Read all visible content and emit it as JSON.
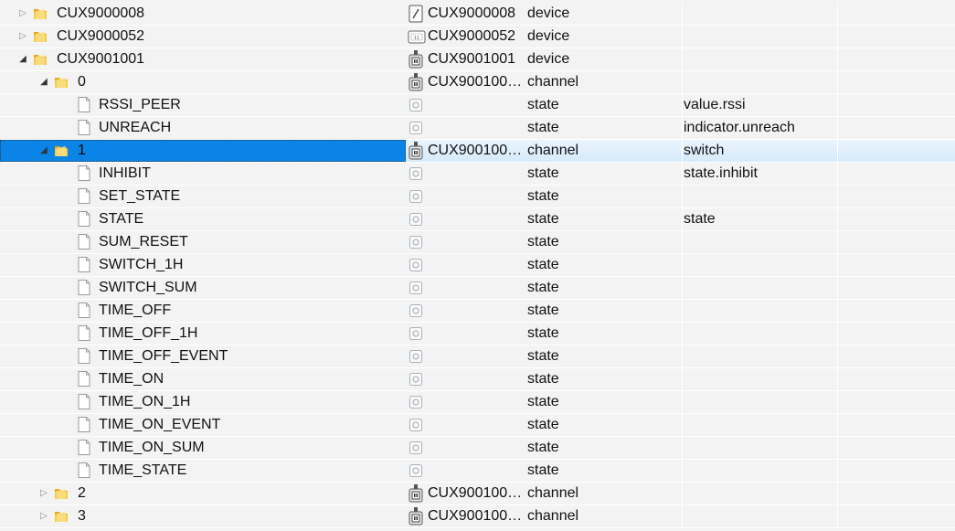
{
  "rows": [
    {
      "level": 1,
      "toggle": "collapsed",
      "kind": "folder",
      "name": "CUX9000008",
      "icon": "wall-switch-device-icon",
      "id": "CUX9000008",
      "type": "device",
      "role": ""
    },
    {
      "level": 1,
      "toggle": "collapsed",
      "kind": "folder",
      "name": "CUX9000052",
      "icon": "display-device-icon",
      "id": "CUX9000052",
      "type": "device",
      "role": ""
    },
    {
      "level": 1,
      "toggle": "expanded",
      "kind": "folder",
      "name": "CUX9001001",
      "icon": "plug-device-icon",
      "id": "CUX9001001",
      "type": "device",
      "role": ""
    },
    {
      "level": 2,
      "toggle": "expanded",
      "kind": "folder",
      "name": "0",
      "icon": "plug-device-icon",
      "id": "CUX900100…",
      "type": "channel",
      "role": ""
    },
    {
      "level": 3,
      "toggle": "none",
      "kind": "file",
      "name": "RSSI_PEER",
      "icon": "state-icon",
      "id": "",
      "type": "state",
      "role": "value.rssi"
    },
    {
      "level": 3,
      "toggle": "none",
      "kind": "file",
      "name": "UNREACH",
      "icon": "state-icon",
      "id": "",
      "type": "state",
      "role": "indicator.unreach"
    },
    {
      "level": 2,
      "toggle": "expanded",
      "kind": "folder",
      "name": "1",
      "icon": "plug-device-icon",
      "id": "CUX900100…",
      "type": "channel",
      "role": "switch",
      "selected": true
    },
    {
      "level": 3,
      "toggle": "none",
      "kind": "file",
      "name": "INHIBIT",
      "icon": "state-icon",
      "id": "",
      "type": "state",
      "role": "state.inhibit"
    },
    {
      "level": 3,
      "toggle": "none",
      "kind": "file",
      "name": "SET_STATE",
      "icon": "state-icon",
      "id": "",
      "type": "state",
      "role": ""
    },
    {
      "level": 3,
      "toggle": "none",
      "kind": "file",
      "name": "STATE",
      "icon": "state-icon",
      "id": "",
      "type": "state",
      "role": "state"
    },
    {
      "level": 3,
      "toggle": "none",
      "kind": "file",
      "name": "SUM_RESET",
      "icon": "state-icon",
      "id": "",
      "type": "state",
      "role": ""
    },
    {
      "level": 3,
      "toggle": "none",
      "kind": "file",
      "name": "SWITCH_1H",
      "icon": "state-icon",
      "id": "",
      "type": "state",
      "role": ""
    },
    {
      "level": 3,
      "toggle": "none",
      "kind": "file",
      "name": "SWITCH_SUM",
      "icon": "state-icon",
      "id": "",
      "type": "state",
      "role": ""
    },
    {
      "level": 3,
      "toggle": "none",
      "kind": "file",
      "name": "TIME_OFF",
      "icon": "state-icon",
      "id": "",
      "type": "state",
      "role": ""
    },
    {
      "level": 3,
      "toggle": "none",
      "kind": "file",
      "name": "TIME_OFF_1H",
      "icon": "state-icon",
      "id": "",
      "type": "state",
      "role": ""
    },
    {
      "level": 3,
      "toggle": "none",
      "kind": "file",
      "name": "TIME_OFF_EVENT",
      "icon": "state-icon",
      "id": "",
      "type": "state",
      "role": ""
    },
    {
      "level": 3,
      "toggle": "none",
      "kind": "file",
      "name": "TIME_ON",
      "icon": "state-icon",
      "id": "",
      "type": "state",
      "role": ""
    },
    {
      "level": 3,
      "toggle": "none",
      "kind": "file",
      "name": "TIME_ON_1H",
      "icon": "state-icon",
      "id": "",
      "type": "state",
      "role": ""
    },
    {
      "level": 3,
      "toggle": "none",
      "kind": "file",
      "name": "TIME_ON_EVENT",
      "icon": "state-icon",
      "id": "",
      "type": "state",
      "role": ""
    },
    {
      "level": 3,
      "toggle": "none",
      "kind": "file",
      "name": "TIME_ON_SUM",
      "icon": "state-icon",
      "id": "",
      "type": "state",
      "role": ""
    },
    {
      "level": 3,
      "toggle": "none",
      "kind": "file",
      "name": "TIME_STATE",
      "icon": "state-icon",
      "id": "",
      "type": "state",
      "role": ""
    },
    {
      "level": 2,
      "toggle": "collapsed",
      "kind": "folder",
      "name": "2",
      "icon": "plug-device-icon",
      "id": "CUX900100…",
      "type": "channel",
      "role": ""
    },
    {
      "level": 2,
      "toggle": "collapsed",
      "kind": "folder",
      "name": "3",
      "icon": "plug-device-icon",
      "id": "CUX900100…",
      "type": "channel",
      "role": ""
    }
  ],
  "colors": {
    "selection": "#0a84e6",
    "row_selected_bg": "#dcedfa",
    "background": "#f3f3f3",
    "folder": "#f2c33a"
  }
}
